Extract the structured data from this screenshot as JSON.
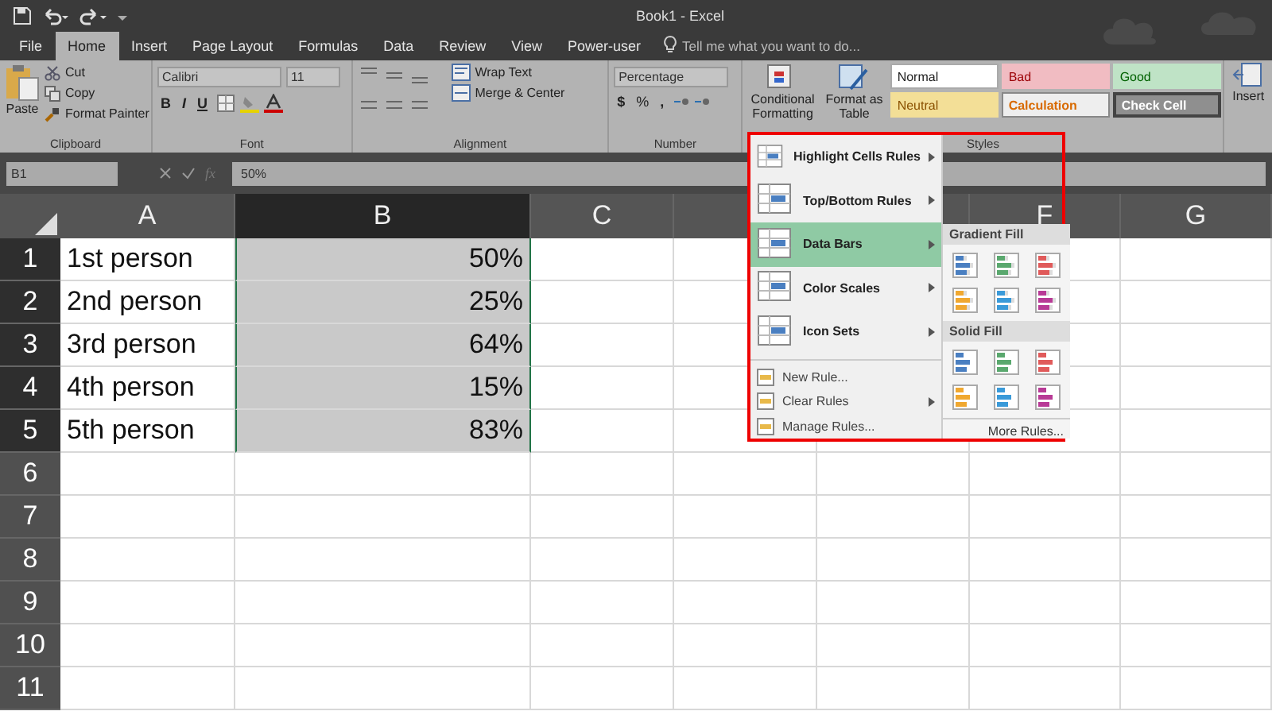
{
  "title_bar": {
    "title": "Book1 - Excel"
  },
  "tabs": [
    {
      "label": "File",
      "selected": false
    },
    {
      "label": "Home",
      "selected": true
    },
    {
      "label": "Insert",
      "selected": false
    },
    {
      "label": "Page Layout",
      "selected": false
    },
    {
      "label": "Formulas",
      "selected": false
    },
    {
      "label": "Data",
      "selected": false
    },
    {
      "label": "Review",
      "selected": false
    },
    {
      "label": "View",
      "selected": false
    },
    {
      "label": "Power-user",
      "selected": false
    }
  ],
  "tell_me": {
    "placeholder": "Tell me what you want to do..."
  },
  "ribbon": {
    "clipboard": {
      "paste": "Paste",
      "cut": "Cut",
      "copy": "Copy",
      "format_painter": "Format Painter",
      "label": "Clipboard"
    },
    "font": {
      "family": "Calibri",
      "size": "11",
      "bold": "B",
      "italic": "I",
      "underline": "U",
      "label": "Font"
    },
    "alignment": {
      "wrap_text": "Wrap Text",
      "merge_center": "Merge & Center",
      "label": "Alignment"
    },
    "number": {
      "format": "Percentage",
      "currency": "$",
      "percent": "%",
      "comma": ",",
      "label": "Number"
    },
    "styles": {
      "conditional_formatting": [
        "Conditional",
        "Formatting"
      ],
      "format_as_table": [
        "Format as",
        "Table"
      ],
      "gallery": [
        {
          "label": "Normal",
          "kind": "normal"
        },
        {
          "label": "Bad",
          "kind": "bad"
        },
        {
          "label": "Good",
          "kind": "good"
        },
        {
          "label": "Neutral",
          "kind": "neutral"
        },
        {
          "label": "Calculation",
          "kind": "calculation"
        },
        {
          "label": "Check Cell",
          "kind": "check"
        }
      ],
      "label": "Styles"
    },
    "insert": "Insert"
  },
  "formula_bar": {
    "name_box": "B1",
    "fx": "fx",
    "value": "50%"
  },
  "sheet": {
    "columns": [
      {
        "label": "A",
        "selected": false
      },
      {
        "label": "B",
        "selected": true
      },
      {
        "label": "C",
        "selected": false
      },
      {
        "selected": false
      },
      {
        "selected": false
      },
      {
        "label": "F",
        "selected": false
      },
      {
        "label": "G",
        "selected": false
      }
    ],
    "rows": [
      {
        "label": "1",
        "selected": true,
        "cells": [
          "1st person",
          "50%"
        ]
      },
      {
        "label": "2",
        "selected": true,
        "cells": [
          "2nd person",
          "25%"
        ]
      },
      {
        "label": "3",
        "selected": true,
        "cells": [
          "3rd person",
          "64%"
        ]
      },
      {
        "label": "4",
        "selected": true,
        "cells": [
          "4th person",
          "15%"
        ]
      },
      {
        "label": "5",
        "selected": true,
        "cells": [
          "5th person",
          "83%"
        ]
      },
      {
        "label": "6",
        "selected": false,
        "cells": []
      },
      {
        "label": "7",
        "selected": false,
        "cells": []
      },
      {
        "label": "8",
        "selected": false,
        "cells": []
      },
      {
        "label": "9",
        "selected": false,
        "cells": []
      },
      {
        "label": "10",
        "selected": false,
        "cells": []
      },
      {
        "label": "11",
        "selected": false,
        "cells": []
      }
    ]
  },
  "menu": {
    "items": [
      {
        "label": "Highlight Cells Rules",
        "kind": "large",
        "submenu": true,
        "selected": false
      },
      {
        "label": "Top/Bottom Rules",
        "kind": "large",
        "submenu": true,
        "selected": false
      },
      {
        "label": "Data Bars",
        "kind": "large",
        "submenu": true,
        "selected": true
      },
      {
        "label": "Color Scales",
        "kind": "large",
        "submenu": true,
        "selected": false
      },
      {
        "label": "Icon Sets",
        "kind": "large",
        "submenu": true,
        "selected": false
      },
      {
        "label": "New Rule...",
        "kind": "small",
        "submenu": false,
        "selected": false
      },
      {
        "label": "Clear Rules",
        "kind": "small",
        "submenu": true,
        "selected": false
      },
      {
        "label": "Manage Rules...",
        "kind": "small",
        "submenu": false,
        "selected": false
      }
    ],
    "submenu": {
      "sections": [
        {
          "title": "Gradient Fill",
          "kind": "gradient",
          "swatches": [
            {
              "color": "#4a7fc1"
            },
            {
              "color": "#5aa86e"
            },
            {
              "color": "#e05a5a"
            },
            {
              "color": "#f0a830"
            },
            {
              "color": "#3a9ad9"
            },
            {
              "color": "#b83a96"
            }
          ]
        },
        {
          "title": "Solid Fill",
          "kind": "solid",
          "swatches": [
            {
              "color": "#4a7fc1"
            },
            {
              "color": "#5aa86e"
            },
            {
              "color": "#e05a5a"
            },
            {
              "color": "#f0a830"
            },
            {
              "color": "#3a9ad9"
            },
            {
              "color": "#b83a96"
            }
          ]
        }
      ],
      "more": "More Rules..."
    }
  }
}
